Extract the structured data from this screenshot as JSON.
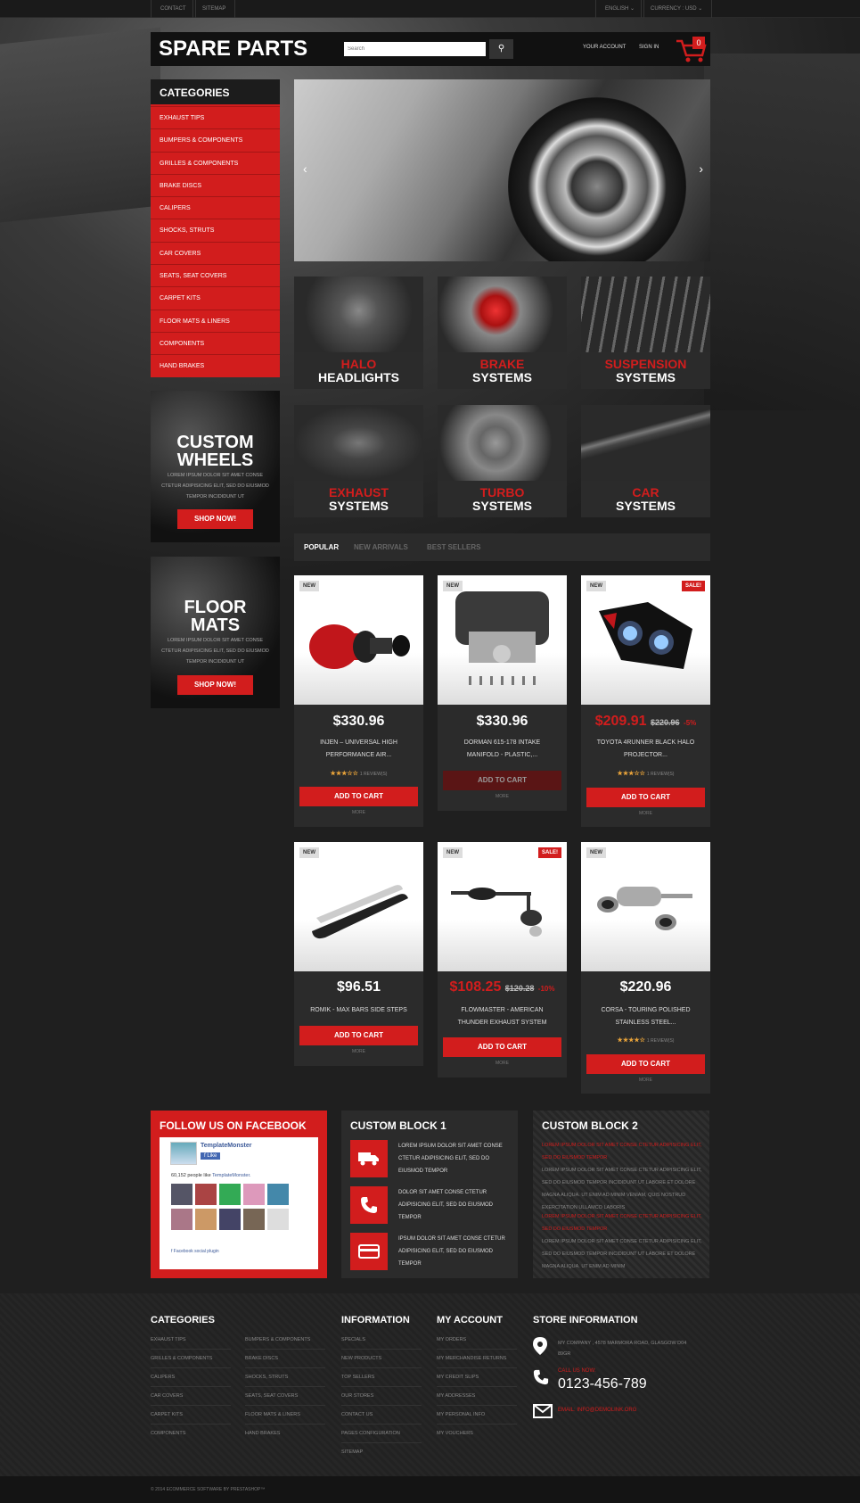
{
  "topbar": {
    "contact": "CONTACT",
    "sitemap": "SITEMAP",
    "language": "ENGLISH",
    "currency": "CURRENCY : USD"
  },
  "header": {
    "logo": "SPARE PARTS",
    "search_placeholder": "Search",
    "your_account": "YOUR ACCOUNT",
    "sign_in": "SIGN IN",
    "cart_count": "0"
  },
  "categories": {
    "title": "CATEGORIES",
    "items": [
      "EXHAUST TIPS",
      "BUMPERS & COMPONENTS",
      "GRILLES & COMPONENTS",
      "BRAKE DISCS",
      "CALIPERS",
      "SHOCKS, STRUTS",
      "CAR COVERS",
      "SEATS, SEAT COVERS",
      "CARPET KITS",
      "FLOOR MATS & LINERS",
      "COMPONENTS",
      "HAND BRAKES"
    ]
  },
  "promos": [
    {
      "title1": "CUSTOM",
      "title2": "WHEELS",
      "text": "LOREM IPSUM DOLOR SIT AMET CONSE CTETUR ADIPISICING ELIT, SED DO EIUSMOD TEMPOR INCIDIDUNT UT",
      "button": "SHOP NOW!"
    },
    {
      "title1": "FLOOR",
      "title2": "MATS",
      "text": "LOREM IPSUM DOLOR SIT AMET CONSE CTETUR ADIPISICING ELIT, SED DO EIUSMOD TEMPOR INCIDIDUNT UT",
      "button": "SHOP NOW!"
    }
  ],
  "slider": {
    "prev": "‹",
    "next": "›"
  },
  "tiles": [
    {
      "red": "HALO",
      "white": "HEADLIGHTS"
    },
    {
      "red": "BRAKE",
      "white": "SYSTEMS"
    },
    {
      "red": "SUSPENSION",
      "white": "SYSTEMS"
    },
    {
      "red": "EXHAUST",
      "white": "SYSTEMS"
    },
    {
      "red": "TURBO",
      "white": "SYSTEMS"
    },
    {
      "red": "CAR",
      "white": "SYSTEMS"
    }
  ],
  "tabs": [
    "POPULAR",
    "NEW ARRIVALS",
    "BEST SELLERS"
  ],
  "products": [
    {
      "badge": "NEW",
      "price": "$330.96",
      "name1": "INJEN – UNIVERSAL HIGH",
      "name2": "PERFORMANCE AIR...",
      "stars": "★★★☆☆",
      "reviews": "1 REVIEW(S)",
      "button": "ADD TO CART",
      "more": "MORE"
    },
    {
      "badge": "NEW",
      "price": "$330.96",
      "name1": "DORMAN 615-178 INTAKE",
      "name2": "MANIFOLD - PLASTIC,...",
      "button": "ADD TO CART",
      "more": "MORE"
    },
    {
      "badge": "NEW",
      "sale": "SALE!",
      "price": "$209.91",
      "old": "$220.96",
      "disc": "-5%",
      "name1": "TOYOTA 4RUNNER BLACK HALO",
      "name2": "PROJECTOR...",
      "stars": "★★★☆☆",
      "reviews": "1 REVIEW(S)",
      "button": "ADD TO CART",
      "more": "MORE"
    },
    {
      "badge": "NEW",
      "price": "$96.51",
      "name1": "ROMIK - MAX BARS SIDE STEPS",
      "button": "ADD TO CART",
      "more": "MORE"
    },
    {
      "badge": "NEW",
      "sale": "SALE!",
      "price": "$108.25",
      "old": "$120.28",
      "disc": "-10%",
      "name1": "FLOWMASTER - AMERICAN",
      "name2": "THUNDER EXHAUST SYSTEM",
      "button": "ADD TO CART",
      "more": "MORE"
    },
    {
      "badge": "NEW",
      "price": "$220.96",
      "name1": "CORSA - TOURING POLISHED",
      "name2": "STAINLESS STEEL...",
      "stars": "★★★★☆",
      "reviews": "1 REVIEW(S)",
      "button": "ADD TO CART",
      "more": "MORE"
    }
  ],
  "facebook": {
    "title": "FOLLOW US ON FACEBOOK",
    "page": "TemplateMonster",
    "like": "Like",
    "count": "60,152 people like",
    "count_link": "TemplateMonster.",
    "plugin": "Facebook social plugin"
  },
  "custom1": {
    "title": "CUSTOM BLOCK 1",
    "rows": [
      {
        "icon": "truck-icon",
        "text": "LOREM IPSUM DOLOR SIT AMET CONSE CTETUR ADIPISICING ELIT, SED DO EIUSMOD TEMPOR"
      },
      {
        "icon": "phone-icon",
        "text": "DOLOR SIT AMET CONSE CTETUR ADIPISICING ELIT, SED DO EIUSMOD TEMPOR"
      },
      {
        "icon": "card-icon",
        "text": "IPSUM DOLOR SIT AMET CONSE CTETUR ADIPISICING ELIT, SED DO EIUSMOD TEMPOR"
      }
    ]
  },
  "custom2": {
    "title": "CUSTOM BLOCK 2",
    "red1": "LOREM IPSUM DOLOR SIT AMET CONSE CTETUR ADIPISICING ELIT, SED DO EIUSMOD TEMPOR",
    "grey1": "LOREM IPSUM DOLOR SIT AMET CONSE CTETUR ADIPISICING ELIT, SED DO EIUSMOD TEMPOR INCIDIDUNT UT LABORE ET DOLORE MAGNA ALIQUA. UT ENIM AD MINIM VENIAM, QUIS NOSTRUD EXERCITATION ULLAMCO LABORIS",
    "red2": "LOREM IPSUM DOLOR SIT AMET CONSE CTETUR ADIPISICING ELIT, SED DO EIUSMOD TEMPOR",
    "grey2": "LOREM IPSUM DOLOR SIT AMET CONSE CTETUR ADIPISICING ELIT, SED DO EIUSMOD TEMPOR INCIDIDUNT UT LABORE ET DOLORE MAGNA ALIQUA. UT ENIM AD MINIM"
  },
  "footer": {
    "categories_title": "CATEGORIES",
    "categories_col1": [
      "EXHAUST TIPS",
      "GRILLES & COMPONENTS",
      "CALIPERS",
      "CAR COVERS",
      "CARPET KITS",
      "COMPONENTS"
    ],
    "categories_col2": [
      "BUMPERS & COMPONENTS",
      "BRAKE DISCS",
      "SHOCKS, STRUTS",
      "SEATS, SEAT COVERS",
      "FLOOR MATS & LINERS",
      "HAND BRAKES"
    ],
    "information_title": "INFORMATION",
    "information": [
      "SPECIALS",
      "NEW PRODUCTS",
      "TOP SELLERS",
      "OUR STORES",
      "CONTACT US",
      "PAGES CONFIGURATION",
      "SITEMAP"
    ],
    "account_title": "MY ACCOUNT",
    "account": [
      "MY ORDERS",
      "MY MERCHANDISE RETURNS",
      "MY CREDIT SLIPS",
      "MY ADDRESSES",
      "MY PERSONAL INFO",
      "MY VOUCHERS"
    ],
    "store_title": "STORE INFORMATION",
    "address": "MY COMPANY , 4578 MARMORA ROAD, GLASGOW D04 89GR",
    "call_label": "CALL US NOW:",
    "phone": "0123-456-789",
    "email": "EMAIL: INFO@DEMOLINK.ORG"
  },
  "copyright": "© 2014 ECOMMERCE SOFTWARE BY PRESTASHOP™"
}
